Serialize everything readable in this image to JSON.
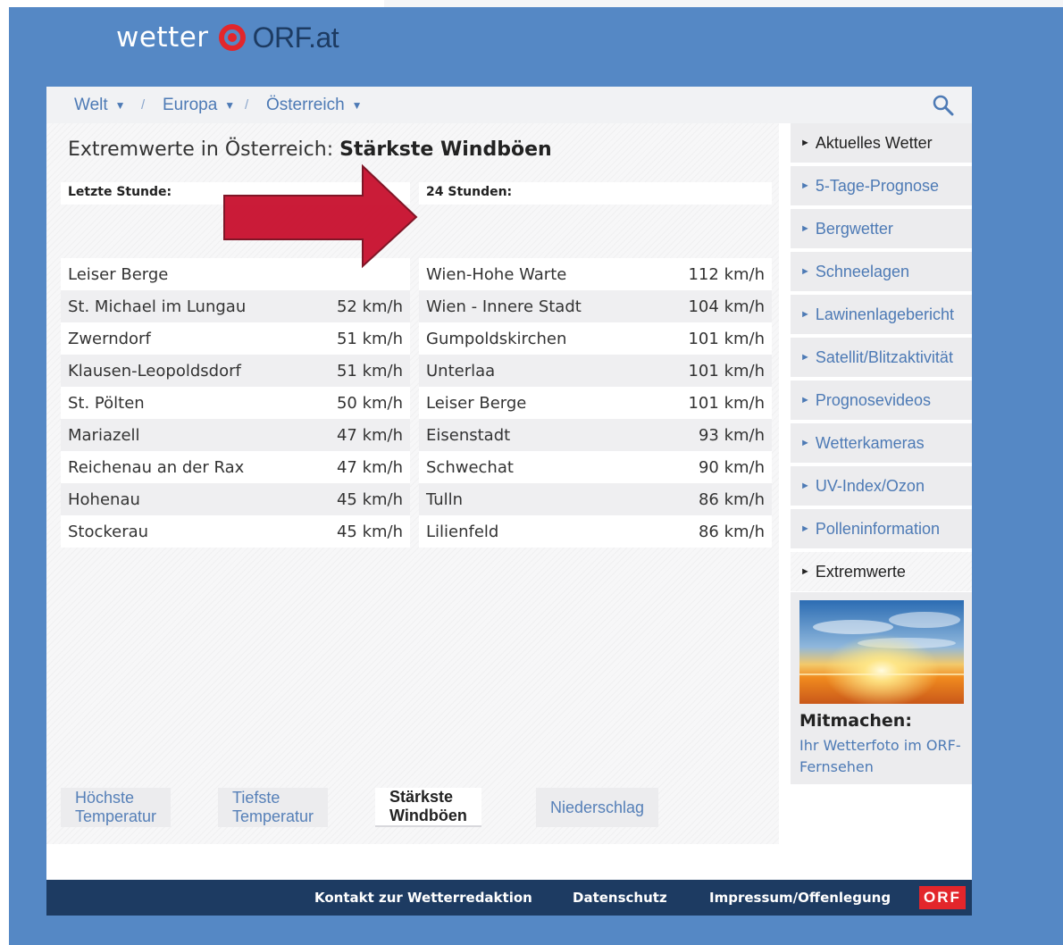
{
  "logo": {
    "wetter": "wetter",
    "orf": "ORF.at"
  },
  "breadcrumb": [
    {
      "label": "Welt"
    },
    {
      "label": "Europa"
    },
    {
      "label": "Österreich"
    }
  ],
  "heading": {
    "prefix": "Extremwerte in Österreich:",
    "bold": "Stärkste Windböen"
  },
  "last_hour": {
    "header": "Letzte Stunde:",
    "rows": [
      {
        "loc": "Leiser Berge",
        "val": ""
      },
      {
        "loc": "St. Michael im Lungau",
        "val": "52 km/h"
      },
      {
        "loc": "Zwerndorf",
        "val": "51 km/h"
      },
      {
        "loc": "Klausen-Leopoldsdorf",
        "val": "51 km/h"
      },
      {
        "loc": "St. Pölten",
        "val": "50 km/h"
      },
      {
        "loc": "Mariazell",
        "val": "47 km/h"
      },
      {
        "loc": "Reichenau an der Rax",
        "val": "47 km/h"
      },
      {
        "loc": "Hohenau",
        "val": "45 km/h"
      },
      {
        "loc": "Stockerau",
        "val": "45 km/h"
      }
    ]
  },
  "day": {
    "header": "24 Stunden:",
    "rows": [
      {
        "loc": "Wien-Hohe Warte",
        "val": "112 km/h"
      },
      {
        "loc": "Wien - Innere Stadt",
        "val": "104 km/h"
      },
      {
        "loc": "Gumpoldskirchen",
        "val": "101 km/h"
      },
      {
        "loc": "Unterlaa",
        "val": "101 km/h"
      },
      {
        "loc": "Leiser Berge",
        "val": "101 km/h"
      },
      {
        "loc": "Eisenstadt",
        "val": "93 km/h"
      },
      {
        "loc": "Schwechat",
        "val": "90 km/h"
      },
      {
        "loc": "Tulln",
        "val": "86 km/h"
      },
      {
        "loc": "Lilienfeld",
        "val": "86 km/h"
      }
    ]
  },
  "tabs": [
    {
      "label": "Höchste Temperatur"
    },
    {
      "label": "Tiefste Temperatur"
    },
    {
      "label": "Stärkste Windböen"
    },
    {
      "label": "Niederschlag"
    }
  ],
  "sidebar": {
    "items": [
      {
        "label": "Aktuelles Wetter"
      },
      {
        "label": "5-Tage-Prognose"
      },
      {
        "label": "Bergwetter"
      },
      {
        "label": "Schneelagen"
      },
      {
        "label": "Lawinenlagebericht"
      },
      {
        "label": "Satellit/Blitzaktivität"
      },
      {
        "label": "Prognosevideos"
      },
      {
        "label": "Wetterkameras"
      },
      {
        "label": "UV-Index/Ozon"
      },
      {
        "label": "Polleninformation"
      },
      {
        "label": "Extremwerte"
      }
    ],
    "promo": {
      "title": "Mitmachen:",
      "text": "Ihr Wetterfoto im ORF-Fernsehen"
    }
  },
  "footer": {
    "links": [
      "Kontakt zur Wetterredaktion",
      "Datenschutz",
      "Impressum/Offenlegung"
    ],
    "badge": "ORF"
  },
  "colors": {
    "frame": "#5588c5",
    "link": "#4d7ab5",
    "footer": "#1d3b62",
    "orf_red": "#e3262b",
    "annotation_arrow": "#c8102e"
  }
}
